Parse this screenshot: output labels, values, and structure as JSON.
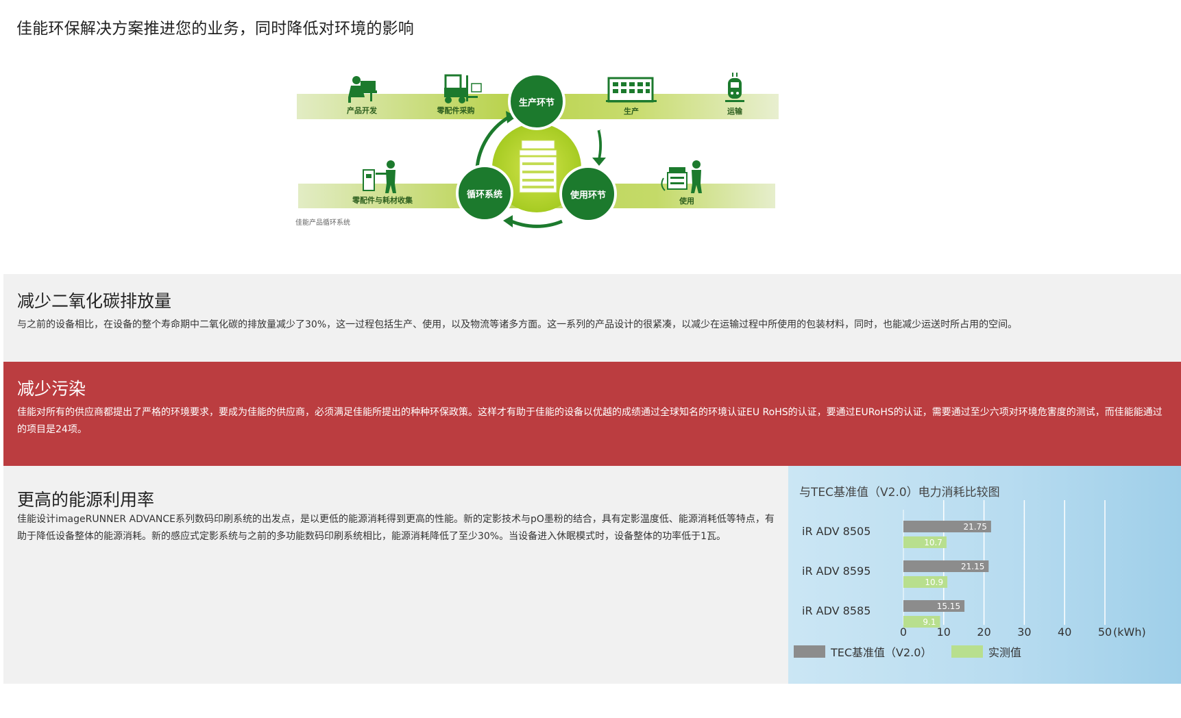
{
  "page": {
    "title": "佳能环保解决方案推进您的业务，同时降低对环境的影响"
  },
  "cycle_diagram": {
    "caption": "佳能产品循环系统",
    "top_labels": [
      "产品开发",
      "零配件采购",
      "生产",
      "运输"
    ],
    "bottom_labels": [
      "零配件与耗材收集",
      "使用"
    ],
    "nodes": {
      "production": "生产环节",
      "use": "使用环节",
      "recycle": "循环系统"
    },
    "colors": {
      "dark_green": "#1c7a2d",
      "lime": "#a8cc2c",
      "band": "#c6dc6c"
    }
  },
  "sections": {
    "co2": {
      "title": "减少二氧化碳排放量",
      "body": "与之前的设备相比，在设备的整个寿命期中二氧化碳的排放量减少了30%，这一过程包括生产、使用，以及物流等诸多方面。这一系列的产品设计的很紧凑，以减少在运输过程中所使用的包装材料，同时，也能减少运送时所占用的空间。"
    },
    "pollution": {
      "title": "减少污染",
      "body": "佳能对所有的供应商都提出了严格的环境要求，要成为佳能的供应商，必须满足佳能所提出的种种环保政策。这样才有助于佳能的设备以优越的成绩通过全球知名的环境认证EU RoHS的认证，要通过EURoHS的认证，需要通过至少六项对环境危害度的测试，而佳能能通过的项目是24项。",
      "background_color": "#bb3d40"
    },
    "energy": {
      "title": "更高的能源利用率",
      "body": "佳能设计imageRUNNER ADVANCE系列数码印刷系统的出发点，是以更低的能源消耗得到更高的性能。新的定影技术与pO墨粉的结合，具有定影温度低、能源消耗低等特点，有助于降低设备整体的能源消耗。新的感应式定影系统与之前的多功能数码印刷系统相比，能源消耗降低了至少30%。当设备进入休眠模式时，设备整体的功率低于1瓦。"
    }
  },
  "chart_data": {
    "type": "bar",
    "orientation": "horizontal",
    "title": "与TEC基准值（V2.0）电力消耗比较图",
    "categories": [
      "iR ADV 8505",
      "iR ADV 8595",
      "iR ADV 8585"
    ],
    "series": [
      {
        "name": "TEC基准值（V2.0）",
        "values": [
          21.75,
          21.15,
          15.15
        ],
        "color": "#8c8c8c"
      },
      {
        "name": "实测值",
        "values": [
          10.7,
          10.9,
          9.1
        ],
        "color": "#b8df8e"
      }
    ],
    "value_labels": [
      [
        "21.75",
        "21.15",
        "15.15"
      ],
      [
        "10.7",
        "10.9",
        "9.1"
      ]
    ],
    "xticks": [
      0,
      10,
      20,
      30,
      40,
      50
    ],
    "xtick_labels": [
      "0",
      "10",
      "20",
      "30",
      "40",
      "50"
    ],
    "xunit": "(kWh)",
    "xlim": [
      0,
      50
    ],
    "grid": true,
    "legend": "bottom"
  }
}
